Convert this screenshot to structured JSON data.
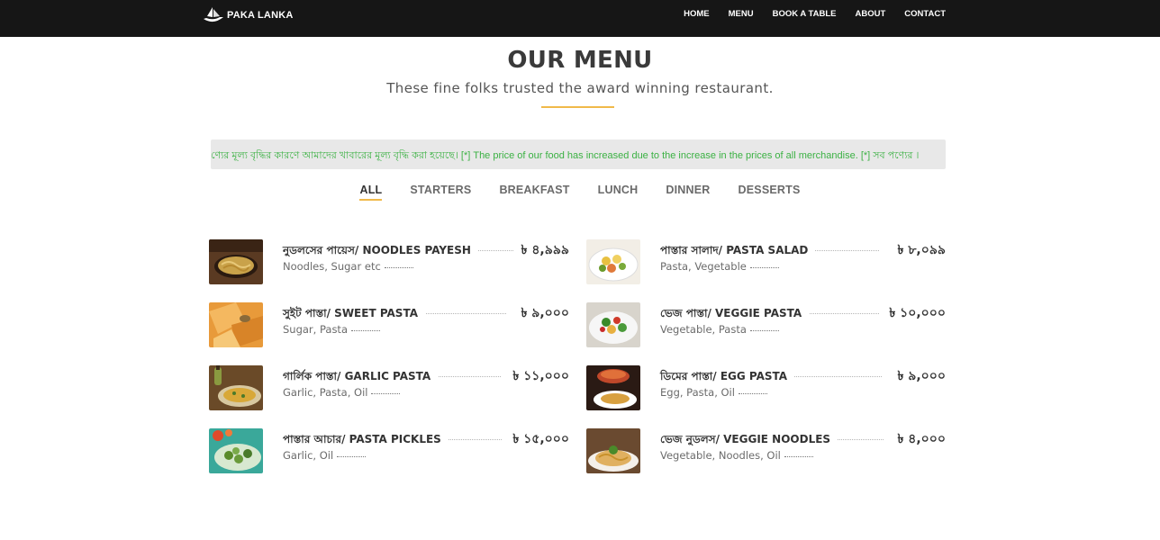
{
  "header": {
    "brand": "PAKA LANKA",
    "nav": [
      "HOME",
      "MENU",
      "BOOK A TABLE",
      "ABOUT",
      "CONTACT"
    ]
  },
  "section": {
    "title": "OUR MENU",
    "subtitle": "These fine folks trusted the award winning restaurant."
  },
  "notice": {
    "text": "ণ্যের মূল্য বৃদ্ধির কারণে আমাদের খাবারের মূল্য বৃদ্ধি করা হয়েছে। [*] The price of our food has increased due to the increase in the prices of all merchandise. [*] সব পণ্যের ।",
    "color": "#3bb143"
  },
  "tabs": [
    "ALL",
    "STARTERS",
    "BREAKFAST",
    "LUNCH",
    "DINNER",
    "DESSERTS"
  ],
  "menu": {
    "left": [
      {
        "name": "নুডলসের পায়েস/ NOODLES PAYESH",
        "desc": "Noodles, Sugar etc",
        "price": "৳ ৪,৯৯৯"
      },
      {
        "name": "সুইট পাস্তা/ SWEET PASTA",
        "desc": "Sugar, Pasta",
        "price": "৳ ৯,০০০"
      },
      {
        "name": "গার্লিক পাস্তা/ GARLIC PASTA",
        "desc": "Garlic, Pasta, Oil",
        "price": "৳ ১১,০০০"
      },
      {
        "name": "পাস্তার আচার/ PASTA PICKLES",
        "desc": "Garlic, Oil",
        "price": "৳ ১৫,০০০"
      }
    ],
    "right": [
      {
        "name": "পাস্তার সালাদ/ PASTA SALAD",
        "desc": "Pasta, Vegetable",
        "price": "৳ ৮,০৯৯"
      },
      {
        "name": "ভেজ পাস্তা/ VEGGIE PASTA",
        "desc": "Vegetable, Pasta",
        "price": "৳ ১০,০০০"
      },
      {
        "name": "ডিমের পাস্তা/ EGG PASTA",
        "desc": "Egg, Pasta, Oil",
        "price": "৳ ৯,০০০"
      },
      {
        "name": "ভেজ নুডলস/ VEGGIE NOODLES",
        "desc": "Vegetable, Noodles, Oil",
        "price": "৳ ৪,০০০"
      }
    ]
  },
  "colors": {
    "accent": "#f0b94a",
    "header_bg": "#161616"
  }
}
